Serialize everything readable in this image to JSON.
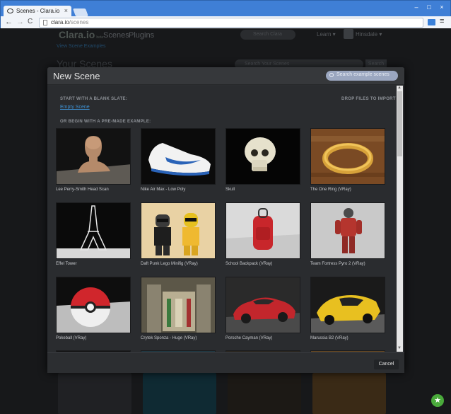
{
  "browser": {
    "tab_title": "Scenes - Clara.io",
    "tab_close": "×",
    "url_host": "clara.io",
    "url_path": "/scenes",
    "back": "←",
    "forward": "→",
    "reload": "C",
    "menu": "≡",
    "window_buttons": [
      "–",
      "□",
      "×"
    ]
  },
  "site": {
    "logo": "Clara.io",
    "logo_badge": "beta",
    "nav": [
      "Scenes",
      "Plugins"
    ],
    "search_placeholder": "Search Clara",
    "learn": "Learn ▾",
    "user": "Hinsdale ▾",
    "subtitle": "View Scene Examples",
    "page_title": "Your Scenes",
    "scenes_search_placeholder": "Search Your Scenes",
    "scenes_search_button": "Search"
  },
  "modal": {
    "title": "New Scene",
    "search_placeholder": "Search example scenes",
    "blank_label": "START WITH A BLANK SLATE:",
    "empty_scene": "Empty Scene",
    "drop_label": "DROP FILES TO IMPORT",
    "premade_label": "OR BEGIN WITH A PRE-MADE EXAMPLE:",
    "cancel": "Cancel",
    "examples": [
      {
        "label": "Lee Perry-Smith Head Scan"
      },
      {
        "label": "Nike Air Max - Low Poly"
      },
      {
        "label": "Skull"
      },
      {
        "label": "The One Ring (VRay)"
      },
      {
        "label": "Effel Tower"
      },
      {
        "label": "Daft Punk Lego Minifig (VRay)"
      },
      {
        "label": "School Backpack (VRay)"
      },
      {
        "label": "Team Fortress Pyro 2 (VRay)"
      },
      {
        "label": "Pokeball (VRay)"
      },
      {
        "label": "Crytek Sponza - Huge (VRay)"
      },
      {
        "label": "Porsche Cayman (VRay)"
      },
      {
        "label": "Marussia B2 (VRay)"
      }
    ]
  },
  "help_icon": "★",
  "colors": {
    "chrome_blue": "#3f7fd6",
    "modal_bg": "#2c2e31",
    "link": "#3d8fd0",
    "help": "#4aaa3b"
  }
}
